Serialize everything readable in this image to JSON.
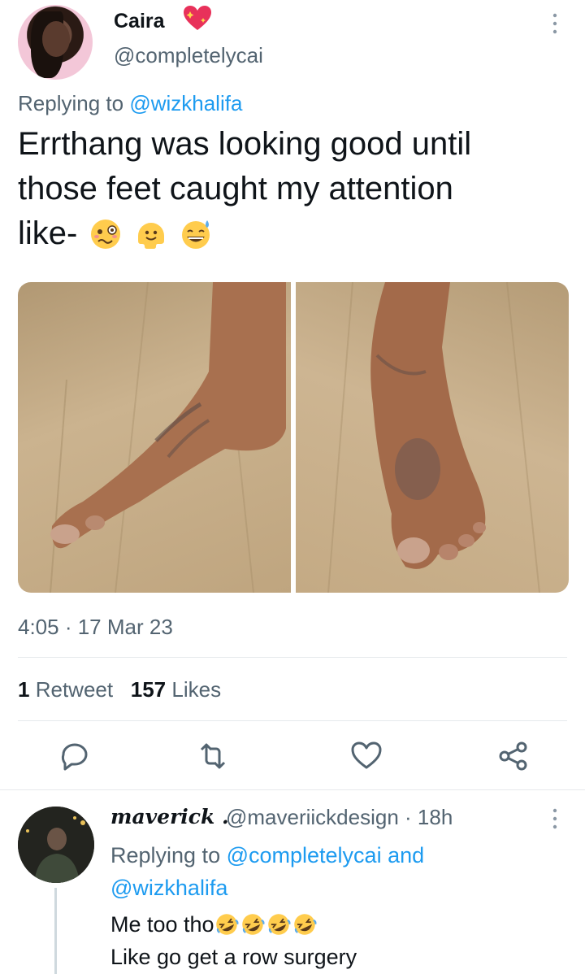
{
  "tweet": {
    "display_name": "Caira",
    "handle": "@completelycai",
    "replying_prefix": "Replying to ",
    "replying_to": "@wizkhalifa",
    "text_line1": "Errthang was looking good until",
    "text_line2": "those feet caught my attention",
    "text_line3": "like-",
    "emojis": [
      "woozy-face",
      "melting-face",
      "grinning-face-with-sweat"
    ],
    "timestamp": "4:05 · 17 Mar 23",
    "retweet_count": "1",
    "retweet_label": "Retweet",
    "like_count": "157",
    "like_label": "Likes"
  },
  "actions": [
    "reply-icon",
    "retweet-icon",
    "like-icon",
    "share-icon"
  ],
  "reply": {
    "display_name": "maverick .",
    "handle_time": "@maveriickdesign · 18h",
    "replying_prefix": "Replying to ",
    "replying_to_1": "@completelycai",
    "replying_and": " and",
    "replying_to_2": "@wizkhalifa",
    "line1": "Me too tho",
    "line2": "Like go get a row surgery",
    "emojis": [
      "rolling-on-floor-laughing",
      "rolling-on-floor-laughing",
      "rolling-on-floor-laughing",
      "rolling-on-floor-laughing"
    ]
  },
  "colors": {
    "link": "#1d9bf0",
    "secondary_text": "#536471",
    "primary_text": "#0f1419"
  }
}
